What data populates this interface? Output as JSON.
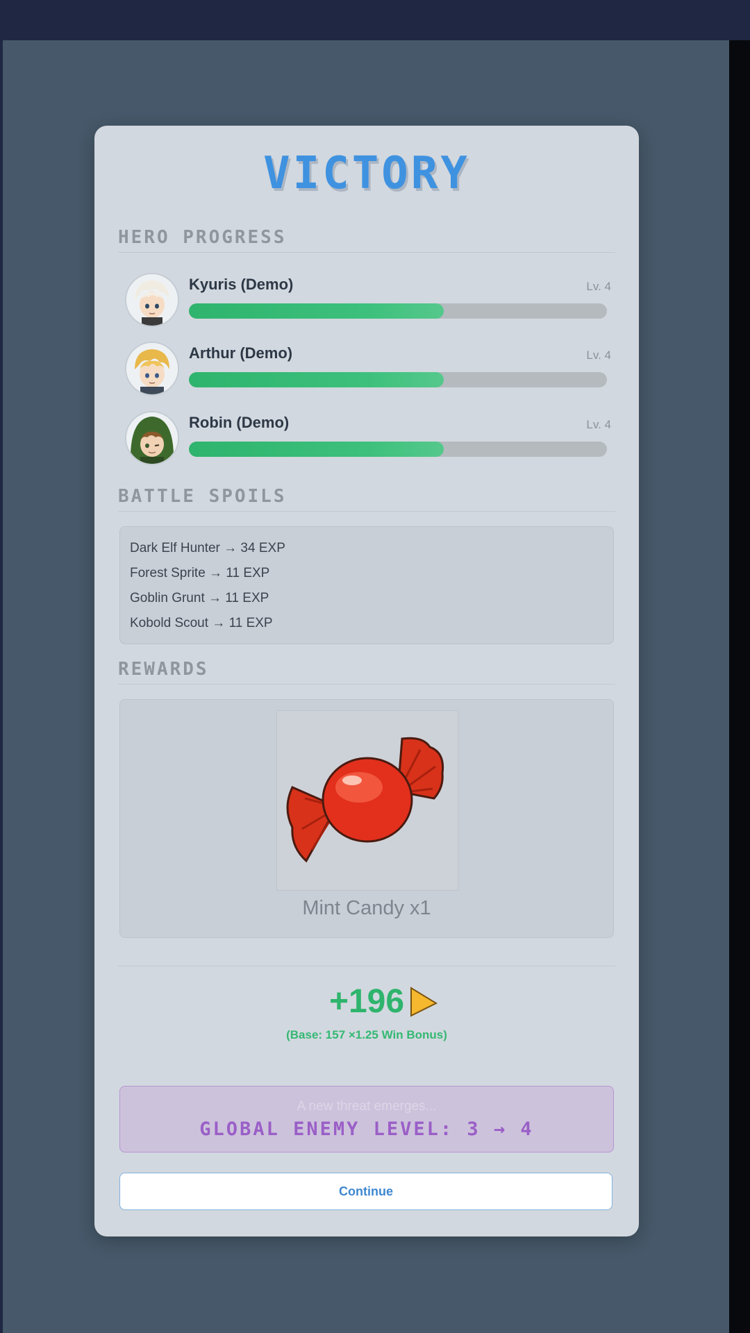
{
  "title": "VICTORY",
  "hero_progress": {
    "heading": "HERO PROGRESS",
    "heroes": [
      {
        "name": "Kyuris (Demo)",
        "level": "Lv. 4",
        "progress": 0.61
      },
      {
        "name": "Arthur (Demo)",
        "level": "Lv. 4",
        "progress": 0.61
      },
      {
        "name": "Robin (Demo)",
        "level": "Lv. 4",
        "progress": 0.61
      }
    ]
  },
  "battle_spoils": {
    "heading": "BATTLE SPOILS",
    "entries": [
      "Dark Elf Hunter → 34 EXP",
      "Forest Sprite → 11 EXP",
      "Goblin Grunt → 11 EXP",
      "Kobold Scout → 11 EXP"
    ]
  },
  "rewards": {
    "heading": "REWARDS",
    "item_label": "Mint Candy x1"
  },
  "exp": {
    "total": "+196",
    "formula": "(Base: 157 ×1.25 Win Bonus)"
  },
  "threat": {
    "subtitle": "A new threat emerges...",
    "label": "GLOBAL ENEMY LEVEL: 3 → 4"
  },
  "continue_label": "Continue",
  "colors": {
    "accent_blue": "#3f92e0",
    "exp_green": "#2eb46d",
    "threat_purple": "#9a5fc7"
  }
}
